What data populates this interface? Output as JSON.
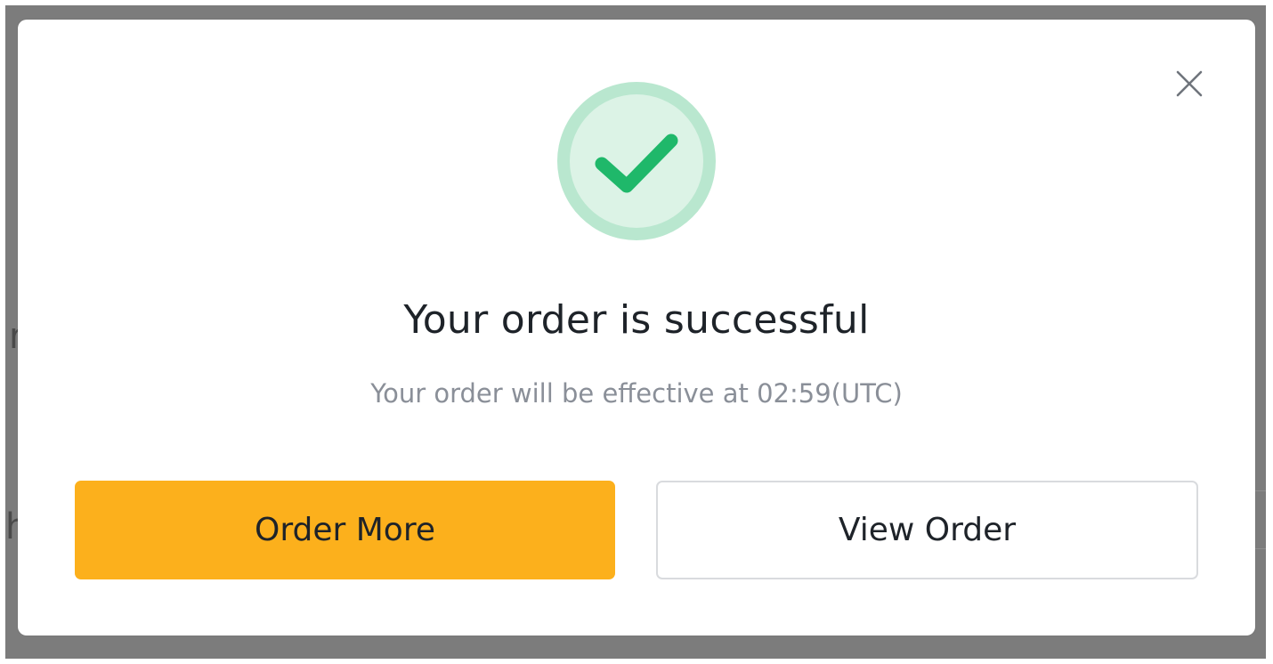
{
  "dialog": {
    "title": "Your order is successful",
    "message": "Your order will be effective at 02:59(UTC)",
    "primary_button": "Order More",
    "secondary_button": "View Order",
    "close_icon": "close-icon",
    "status_icon": "checkmark-icon"
  },
  "colors": {
    "accent": "#fcb01c",
    "success": "#1fb86a",
    "success_ring": "#b9e7cf",
    "success_fill": "#dcf3e6",
    "overlay": "#7c7c7c"
  }
}
